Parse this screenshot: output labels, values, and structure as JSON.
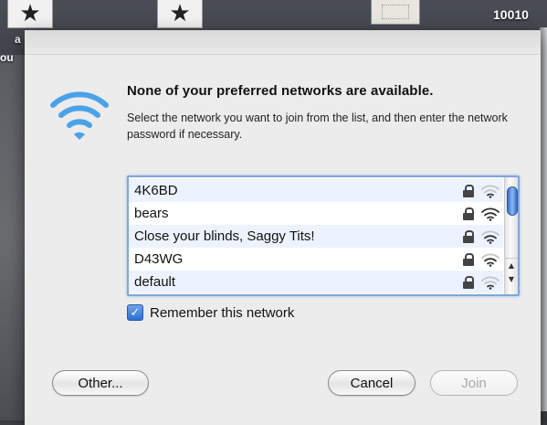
{
  "desktop": {
    "top_right_text": "10010",
    "left_fragment_a": "a",
    "left_fragment_b": "ou"
  },
  "dialog": {
    "headline": "None of your preferred networks are available.",
    "description": "Select the network you want to join from the list, and then enter the network password if necessary.",
    "networks": [
      {
        "name": "4K6BD",
        "secured": true,
        "signal": "weak"
      },
      {
        "name": "bears",
        "secured": true,
        "signal": "strong"
      },
      {
        "name": "Close your blinds, Saggy Tits!",
        "secured": true,
        "signal": "medium"
      },
      {
        "name": "D43WG",
        "secured": true,
        "signal": "medium"
      },
      {
        "name": "default",
        "secured": true,
        "signal": "weak"
      }
    ],
    "remember_label": "Remember this network",
    "remember_checked": true,
    "buttons": {
      "other": "Other...",
      "cancel": "Cancel",
      "join": "Join"
    }
  },
  "colors": {
    "accent": "#2a6fd6",
    "selection_border": "#7fa6d8",
    "row_alt": "#edf3fe"
  }
}
